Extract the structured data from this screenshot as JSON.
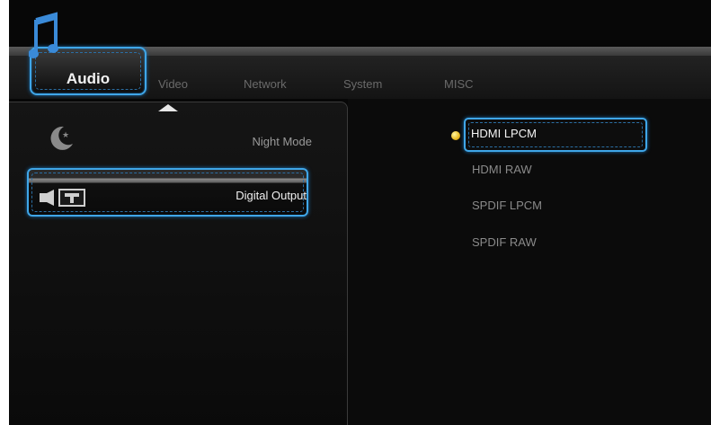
{
  "tabs": [
    {
      "label": "Audio",
      "selected": true
    },
    {
      "label": "Video"
    },
    {
      "label": "Network"
    },
    {
      "label": "System"
    },
    {
      "label": "MISC"
    }
  ],
  "menu": {
    "items": [
      {
        "label": "Night Mode",
        "icon": "moon-icon"
      },
      {
        "label": "Digital Output",
        "icon": "speaker-icon",
        "selected": true
      }
    ]
  },
  "options": {
    "items": [
      {
        "label": "HDMI LPCM",
        "selected": true
      },
      {
        "label": "HDMI RAW"
      },
      {
        "label": "SPDIF LPCM"
      },
      {
        "label": "SPDIF RAW"
      }
    ]
  },
  "colors": {
    "accent": "#3fa6e8",
    "background": "#070707",
    "bullet": "#e8b820"
  }
}
